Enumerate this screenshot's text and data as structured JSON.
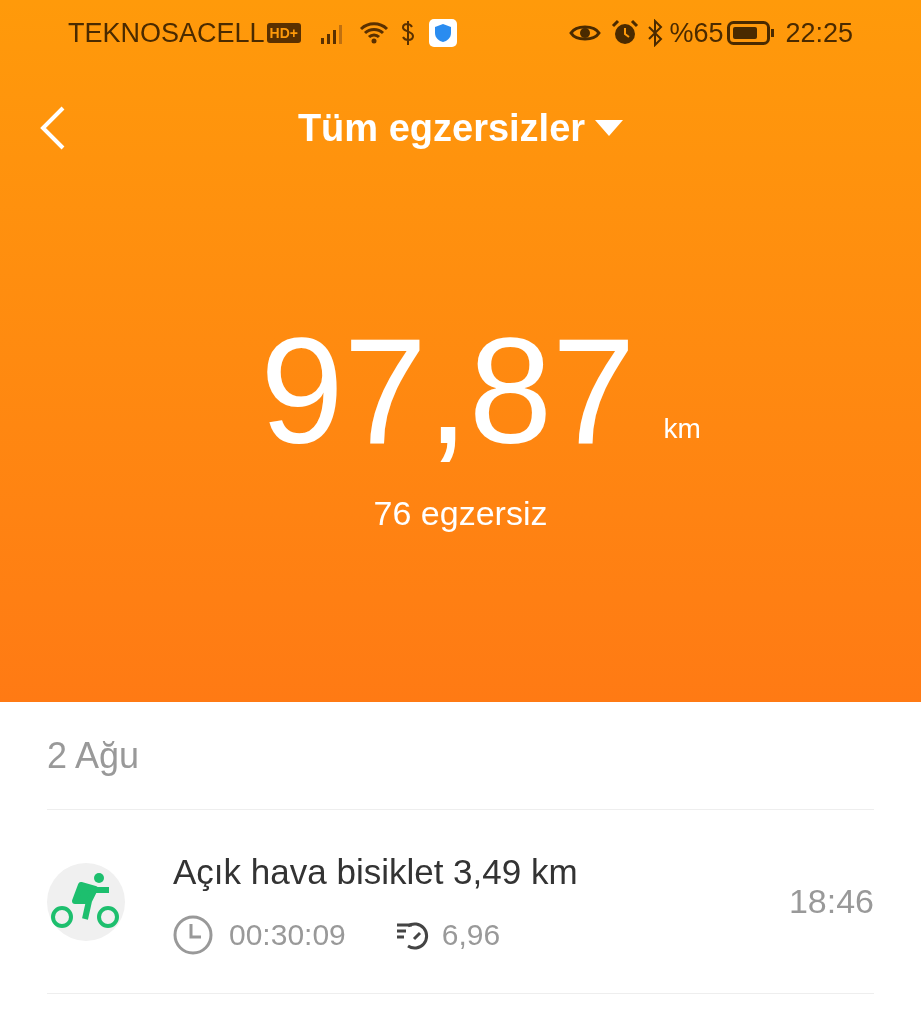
{
  "status_bar": {
    "carrier": "TEKNOSACELL",
    "hd_badge": "HD+",
    "battery_percent": "%65",
    "time": "22:25"
  },
  "header": {
    "title": "Tüm egzersizler"
  },
  "summary": {
    "distance": "97,87",
    "unit": "km",
    "count": "76 egzersiz"
  },
  "sections": [
    {
      "date": "2 Ağu",
      "workouts": [
        {
          "kind": "bike",
          "title": "Açık hava bisiklet 3,49 km",
          "duration": "00:30:09",
          "pace": "6,96",
          "time": "18:46"
        }
      ]
    }
  ]
}
